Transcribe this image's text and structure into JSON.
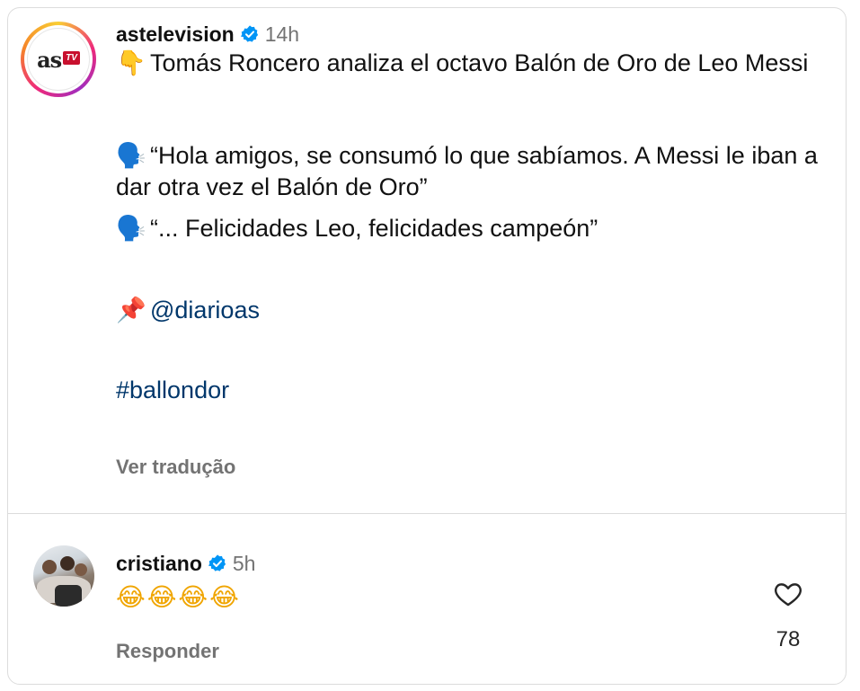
{
  "post": {
    "avatar": {
      "logo_text": "as",
      "logo_badge": "TV"
    },
    "username": "astelevision",
    "time": "14h",
    "caption": {
      "line1_emoji": "👇",
      "line1_text": "Tomás Roncero analiza el octavo Balón de Oro de Leo Messi",
      "quote1_emoji": "🗣️",
      "quote1_text": "“Hola amigos, se consumó lo que sabíamos. A Messi le iban a dar otra vez el Balón de Oro”",
      "quote2_emoji": "🗣️",
      "quote2_text": "“... Felicidades Leo, felicidades campeón”",
      "pin_emoji": "📌",
      "mention": "@diarioas",
      "hashtag": "#ballondor"
    },
    "translate_label": "Ver tradução"
  },
  "comment": {
    "username": "cristiano",
    "time": "5h",
    "text": "😂😂😂😂",
    "reply_label": "Responder",
    "like_count": "78"
  },
  "colors": {
    "verified_blue": "#0095f6",
    "link_blue": "#00376b",
    "muted_gray": "#737373",
    "divider": "#dbdbdb"
  },
  "icons": {
    "verified": "verified-badge-icon",
    "like": "heart-outline-icon"
  }
}
